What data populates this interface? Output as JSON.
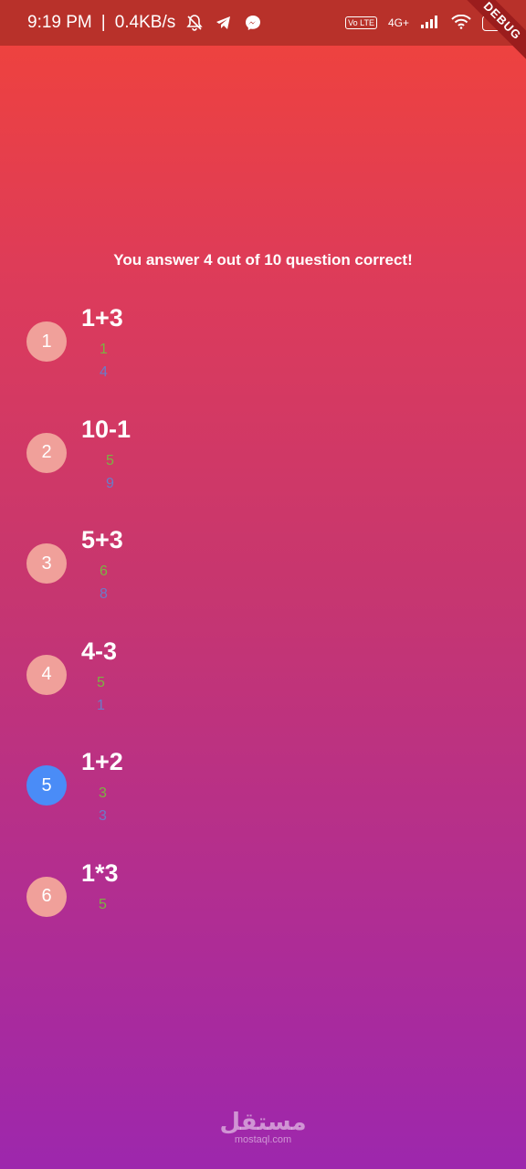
{
  "status": {
    "time": "9:19 PM",
    "separator": "|",
    "speed": "0.4KB/s",
    "volte": "Vo LTE",
    "network": "4G+",
    "battery": "40"
  },
  "debug_ribbon": "DEBUG",
  "score_text": "You answer 4 out of 10 question correct!",
  "questions": [
    {
      "number": "1",
      "text": "1+3",
      "user_answer": "1",
      "correct_answer": "4"
    },
    {
      "number": "2",
      "text": "10-1",
      "user_answer": "5",
      "correct_answer": "9"
    },
    {
      "number": "3",
      "text": "5+3",
      "user_answer": "6",
      "correct_answer": "8"
    },
    {
      "number": "4",
      "text": "4-3",
      "user_answer": "5",
      "correct_answer": "1"
    },
    {
      "number": "5",
      "text": "1+2",
      "user_answer": "3",
      "correct_answer": "3"
    },
    {
      "number": "6",
      "text": "1*3",
      "user_answer": "5",
      "correct_answer": ""
    }
  ],
  "watermark": {
    "arabic": "مستقل",
    "url": "mostaql.com"
  },
  "colors": {
    "circle_default": "#f0a09a",
    "circle_active": "#4a8cf7",
    "user_answer": "#7cb342",
    "correct_answer": "#6a7cc9"
  }
}
